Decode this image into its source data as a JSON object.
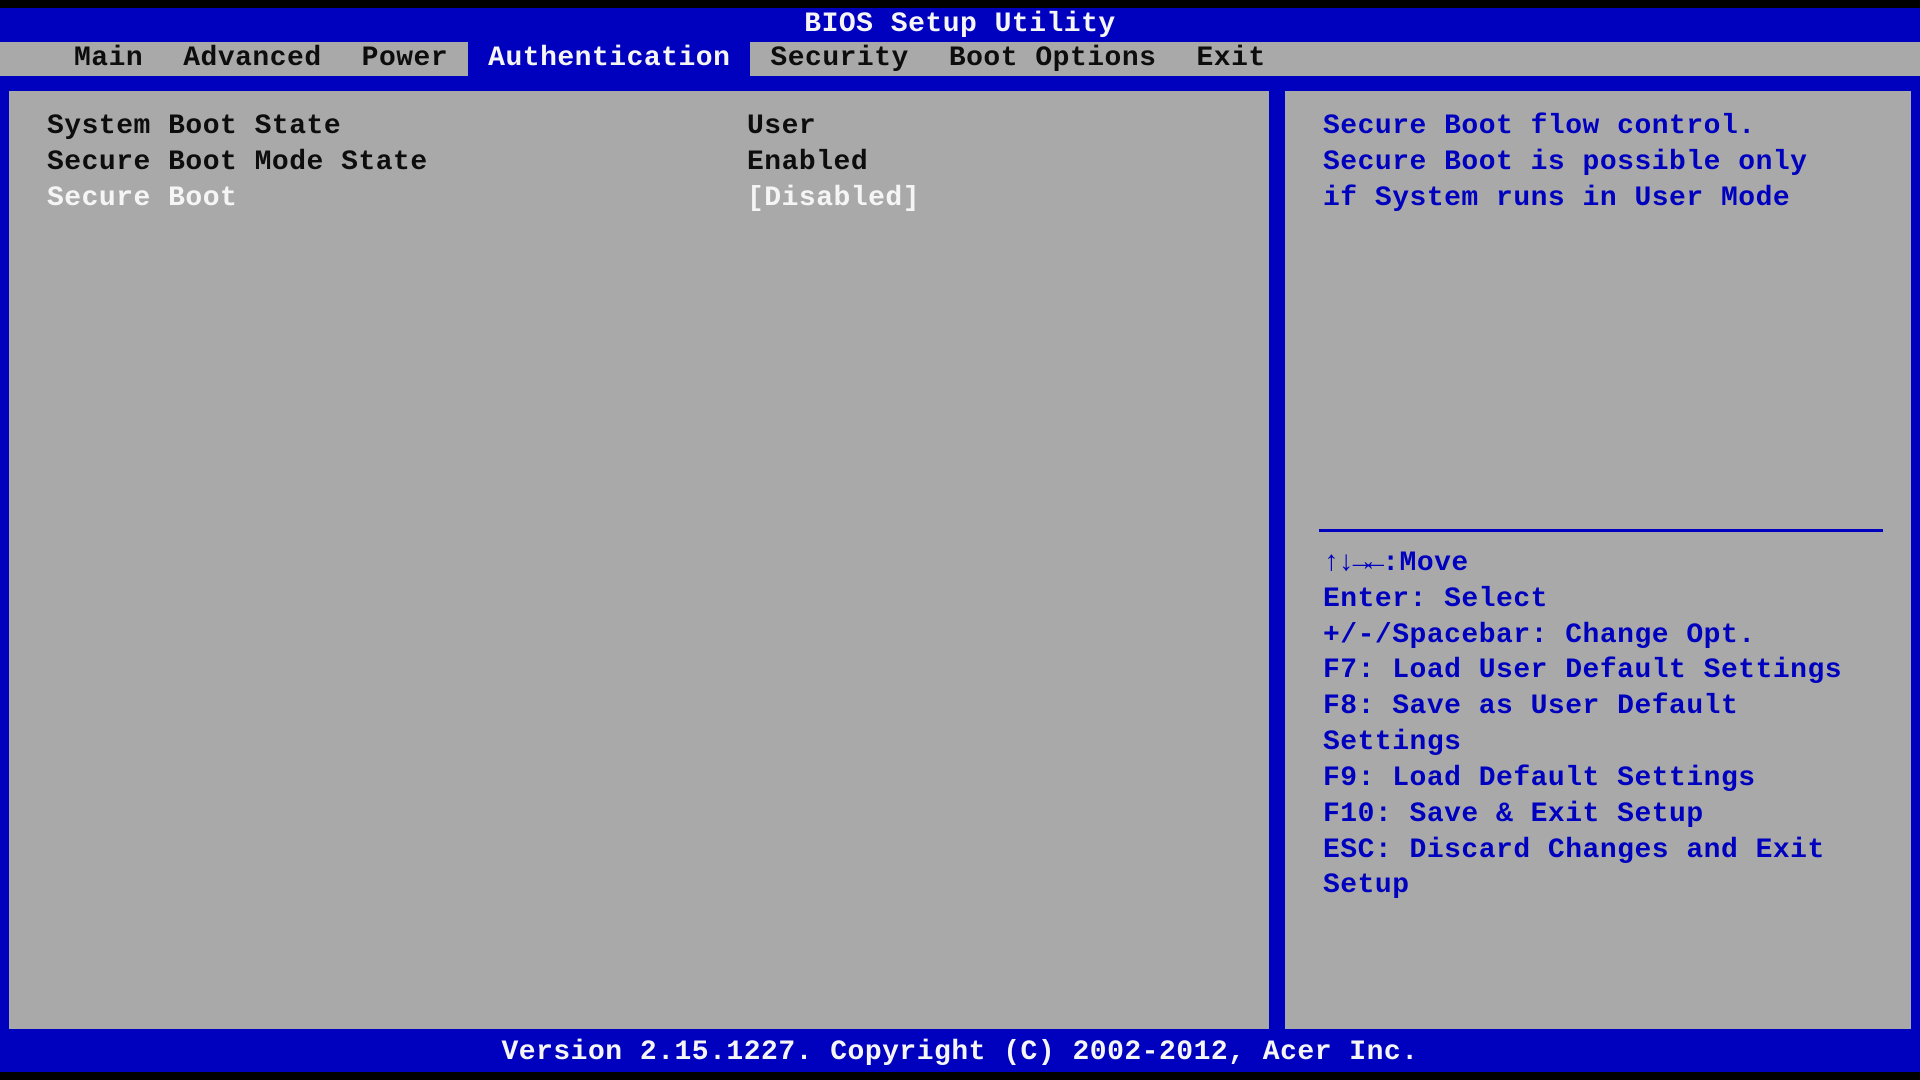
{
  "title": "BIOS Setup Utility",
  "tabs": [
    {
      "label": "Main",
      "active": false
    },
    {
      "label": "Advanced",
      "active": false
    },
    {
      "label": "Power",
      "active": false
    },
    {
      "label": "Authentication",
      "active": true
    },
    {
      "label": "Security",
      "active": false
    },
    {
      "label": "Boot Options",
      "active": false
    },
    {
      "label": "Exit",
      "active": false
    }
  ],
  "settings": [
    {
      "label": "System Boot State",
      "value": "User",
      "selected": false
    },
    {
      "label": "Secure Boot Mode State",
      "value": "Enabled",
      "selected": false
    },
    {
      "label": "Secure Boot",
      "value": "[Disabled]",
      "selected": true
    }
  ],
  "help_text_lines": [
    "Secure Boot flow control.",
    "Secure Boot is possible only",
    "if System runs in User Mode"
  ],
  "key_help": {
    "move_arrows": "↑↓→←",
    "move_label": ":Move",
    "lines": [
      "Enter: Select",
      "+/-/Spacebar: Change Opt.",
      "F7: Load User Default Settings",
      "F8: Save as User Default Settings",
      "F9: Load Default Settings",
      "F10: Save & Exit Setup",
      "ESC: Discard Changes and Exit Setup"
    ]
  },
  "footer": "Version 2.15.1227. Copyright (C) 2002-2012, Acer Inc."
}
